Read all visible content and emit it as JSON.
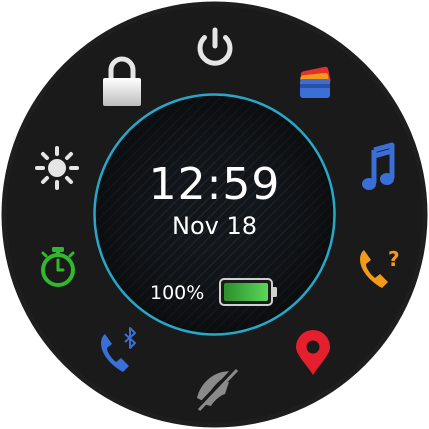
{
  "clock": {
    "time": "12:59",
    "date": "Nov 18"
  },
  "battery": {
    "percent_label": "100%",
    "level": 1.0,
    "fill_color": "#3ec43e"
  },
  "colors": {
    "bezel": "#1e1e1e",
    "face": "#101317",
    "ring": "#27a8c9",
    "app_white": "#e6e6e6",
    "app_blue": "#3b6fd8",
    "app_orange": "#f39a1b",
    "app_green": "#31b82f",
    "app_red": "#e51f2e",
    "app_gray": "#8a8a8a"
  },
  "controls": [
    {
      "id": "power",
      "icon": "power-icon"
    },
    {
      "id": "wallet",
      "icon": "wallet-cards-icon"
    },
    {
      "id": "music",
      "icon": "music-note-icon"
    },
    {
      "id": "find-phone",
      "icon": "phone-question-icon"
    },
    {
      "id": "save-location",
      "icon": "map-pin-icon"
    },
    {
      "id": "do-not-disturb",
      "icon": "satellite-off-icon"
    },
    {
      "id": "phone-bluetooth",
      "icon": "phone-bluetooth-icon"
    },
    {
      "id": "stopwatch",
      "icon": "stopwatch-icon"
    },
    {
      "id": "brightness",
      "icon": "sun-icon"
    },
    {
      "id": "lock",
      "icon": "lock-icon"
    }
  ]
}
